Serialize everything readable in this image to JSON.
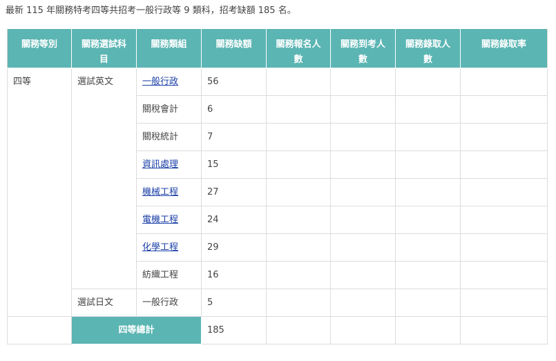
{
  "intro": "最新 115 年關務特考四等共招考一般行政等 9 類科，招考缺額 185 名。",
  "table": {
    "headers": [
      "關務等別",
      "關務選試科目",
      "關務類組",
      "關務缺額",
      "關務報名人數",
      "關務到考人數",
      "關務錄取人數",
      "關務錄取率"
    ],
    "level": "四等",
    "groups": [
      {
        "subject": "選試英文",
        "rows": [
          {
            "category": "一般行政",
            "vacancy": "56",
            "link": true
          },
          {
            "category": "關稅會計",
            "vacancy": "6",
            "link": false
          },
          {
            "category": "關稅統計",
            "vacancy": "7",
            "link": false
          },
          {
            "category": "資訊處理",
            "vacancy": "15",
            "link": true
          },
          {
            "category": "機械工程",
            "vacancy": "27",
            "link": true
          },
          {
            "category": "電機工程",
            "vacancy": "24",
            "link": true
          },
          {
            "category": "化學工程",
            "vacancy": "29",
            "link": true
          },
          {
            "category": "紡織工程",
            "vacancy": "16",
            "link": false
          }
        ]
      },
      {
        "subject": "選試日文",
        "rows": [
          {
            "category": "一般行政",
            "vacancy": "5",
            "link": false
          }
        ]
      }
    ],
    "total_label": "四等總計",
    "total_value": "185"
  }
}
